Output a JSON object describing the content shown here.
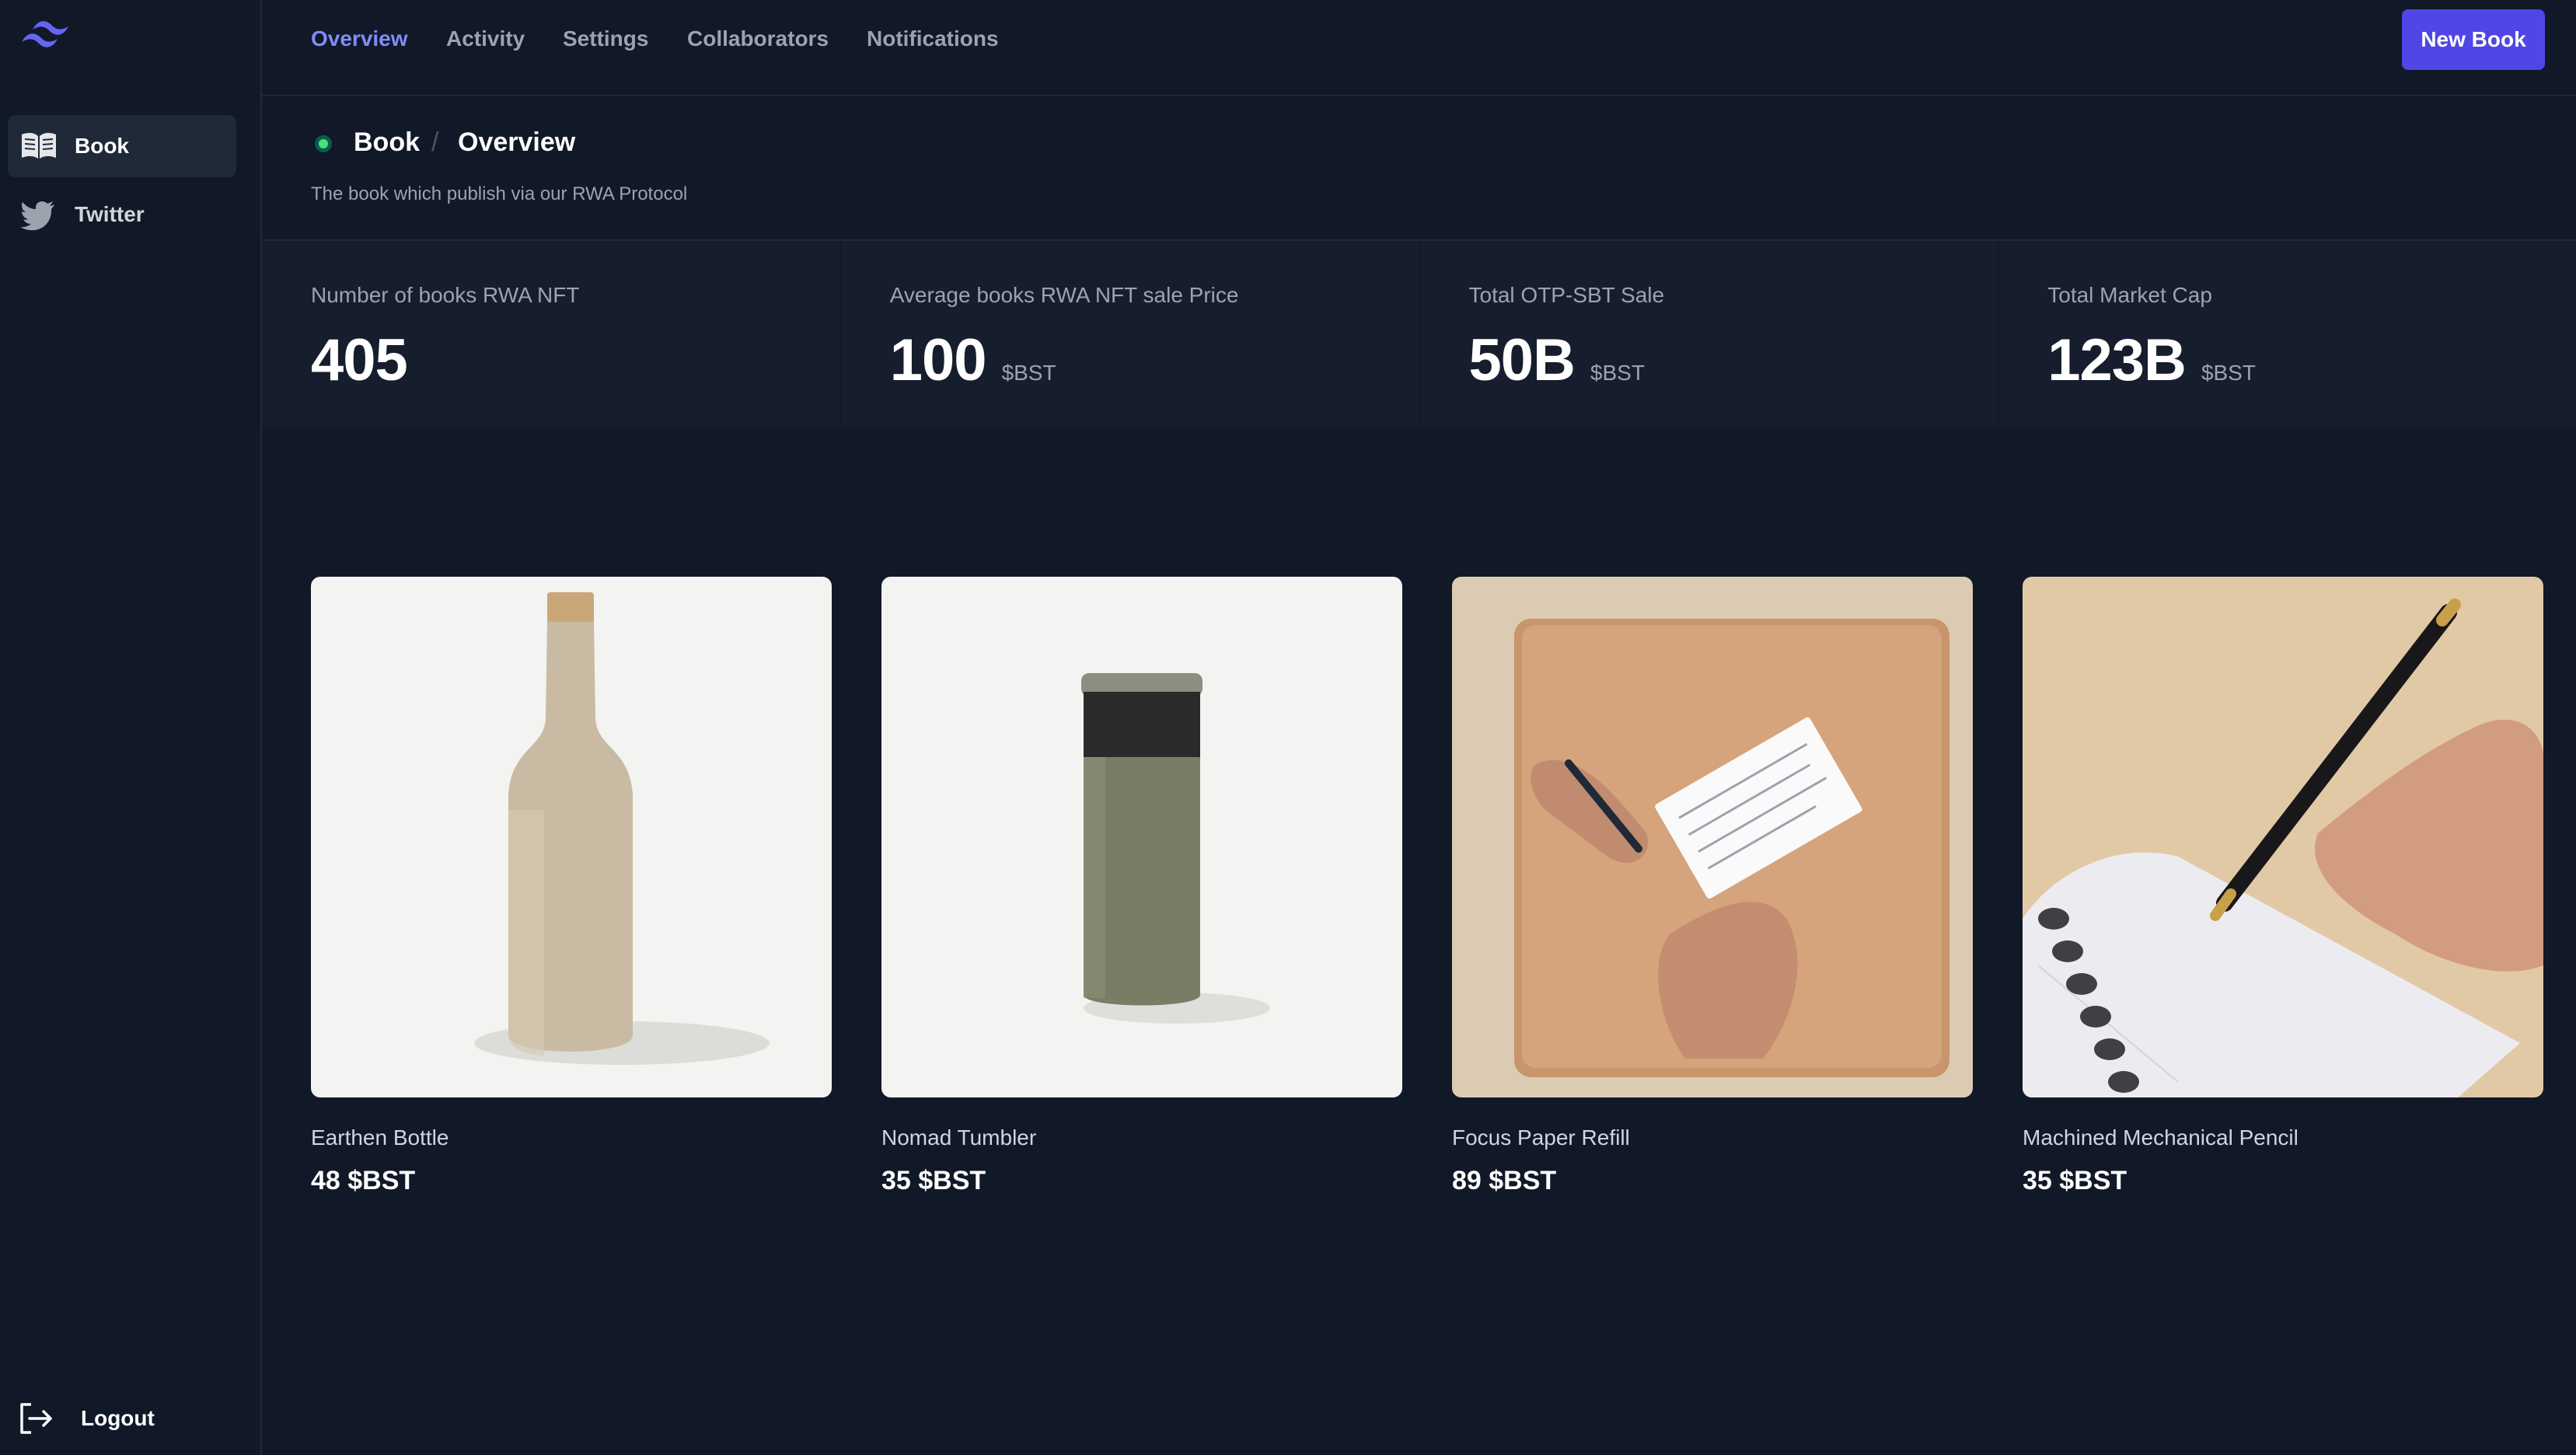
{
  "app": {
    "logo_icon": "tailwind-logo-icon",
    "accent": "#4f46e5"
  },
  "sidebar": {
    "items": [
      {
        "label": "Book",
        "icon": "book-open-icon",
        "active": true
      },
      {
        "label": "Twitter",
        "icon": "twitter-icon",
        "active": false
      }
    ],
    "logout_label": "Logout"
  },
  "topnav": {
    "tabs": [
      {
        "label": "Overview",
        "active": true
      },
      {
        "label": "Activity",
        "active": false
      },
      {
        "label": "Settings",
        "active": false
      },
      {
        "label": "Collaborators",
        "active": false
      },
      {
        "label": "Notifications",
        "active": false
      }
    ],
    "new_book_label": "New Book"
  },
  "header": {
    "breadcrumb": [
      "Book",
      "Overview"
    ],
    "separator": "/",
    "subtitle": "The book which publish via our RWA Protocol"
  },
  "stats": [
    {
      "label": "Number of books RWA NFT",
      "value": "405",
      "unit": ""
    },
    {
      "label": "Average books RWA NFT sale Price",
      "value": "100",
      "unit": "$BST"
    },
    {
      "label": "Total OTP-SBT Sale",
      "value": "50B",
      "unit": "$BST"
    },
    {
      "label": "Total Market Cap",
      "value": "123B",
      "unit": "$BST"
    }
  ],
  "products": [
    {
      "name": "Earthen Bottle",
      "price": "48 $BST"
    },
    {
      "name": "Nomad Tumbler",
      "price": "35 $BST"
    },
    {
      "name": "Focus Paper Refill",
      "price": "89 $BST"
    },
    {
      "name": "Machined Mechanical Pencil",
      "price": "35 $BST"
    }
  ]
}
